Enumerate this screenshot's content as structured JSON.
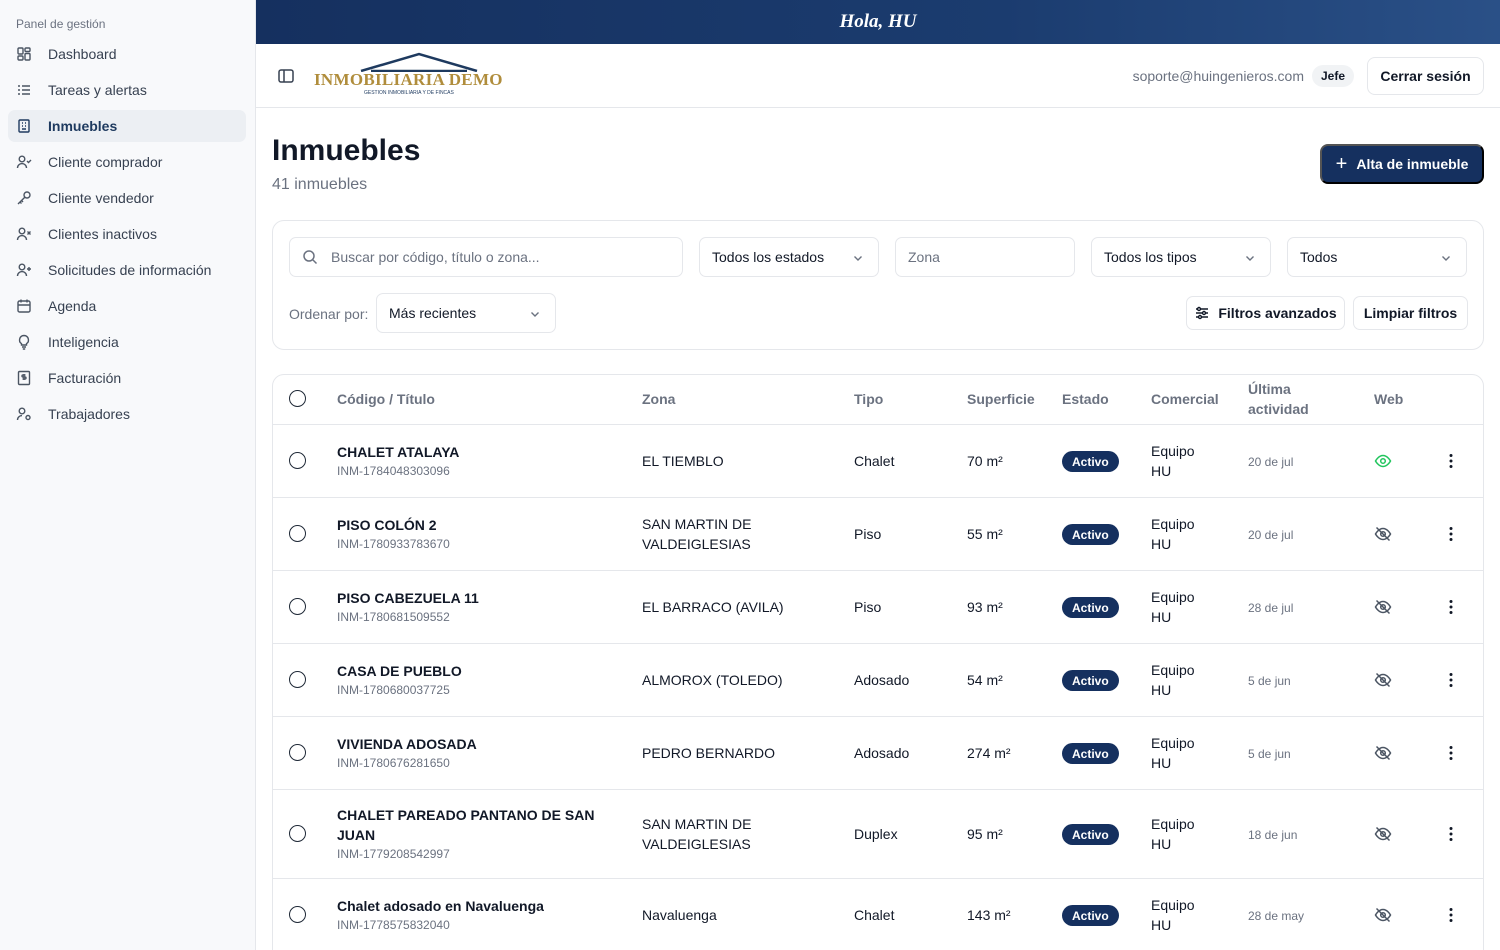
{
  "sidebar": {
    "heading": "Panel de gestión",
    "items": [
      {
        "label": "Dashboard",
        "icon": "dashboard-icon"
      },
      {
        "label": "Tareas y alertas",
        "icon": "list-icon"
      },
      {
        "label": "Inmuebles",
        "icon": "building-icon",
        "active": true
      },
      {
        "label": "Cliente comprador",
        "icon": "user-check-icon"
      },
      {
        "label": "Cliente vendedor",
        "icon": "key-icon"
      },
      {
        "label": "Clientes inactivos",
        "icon": "user-x-icon"
      },
      {
        "label": "Solicitudes de información",
        "icon": "user-plus-icon"
      },
      {
        "label": "Agenda",
        "icon": "calendar-icon"
      },
      {
        "label": "Inteligencia",
        "icon": "lightbulb-icon"
      },
      {
        "label": "Facturación",
        "icon": "receipt-icon"
      },
      {
        "label": "Trabajadores",
        "icon": "user-cog-icon"
      }
    ]
  },
  "banner": {
    "greeting": "Hola, HU"
  },
  "header": {
    "logo_text": "INMOBILIARIA DEMO",
    "logo_subtitle": "GESTION INMOBILIARIA Y DE FINCAS",
    "email": "soporte@huingenieros.com",
    "role": "Jefe",
    "logout_label": "Cerrar sesión"
  },
  "page": {
    "title": "Inmuebles",
    "subtitle": "41 inmuebles",
    "add_button": "Alta de inmueble"
  },
  "filters": {
    "search_placeholder": "Buscar por código, título o zona...",
    "estado": "Todos los estados",
    "zona_placeholder": "Zona",
    "tipo": "Todos los tipos",
    "web": "Todos",
    "sort_label": "Ordenar por:",
    "sort_value": "Más recientes",
    "advanced_label": "Filtros avanzados",
    "clear_label": "Limpiar filtros"
  },
  "table": {
    "headers": {
      "codigo": "Código / Título",
      "zona": "Zona",
      "tipo": "Tipo",
      "superficie": "Superficie",
      "estado": "Estado",
      "comercial": "Comercial",
      "ultima_1": "Última",
      "ultima_2": "actividad",
      "web": "Web"
    },
    "rows": [
      {
        "title": "CHALET ATALAYA",
        "code": "INM-1784048303096",
        "zona": "EL TIEMBLO",
        "tipo": "Chalet",
        "superficie": "70 m²",
        "estado": "Activo",
        "comercial_1": "Equipo",
        "comercial_2": "HU",
        "actividad": "20 de jul",
        "web_visible": true
      },
      {
        "title": "PISO COLÓN 2",
        "code": "INM-1780933783670",
        "zona_1": "SAN MARTIN DE",
        "zona_2": "VALDEIGLESIAS",
        "tipo": "Piso",
        "superficie": "55 m²",
        "estado": "Activo",
        "comercial_1": "Equipo",
        "comercial_2": "HU",
        "actividad": "20 de jul",
        "web_visible": false
      },
      {
        "title": "PISO CABEZUELA 11",
        "code": "INM-1780681509552",
        "zona": "EL BARRACO (AVILA)",
        "tipo": "Piso",
        "superficie": "93 m²",
        "estado": "Activo",
        "comercial_1": "Equipo",
        "comercial_2": "HU",
        "actividad": "28 de jul",
        "web_visible": false
      },
      {
        "title": "CASA DE PUEBLO",
        "code": "INM-1780680037725",
        "zona": "ALMOROX (TOLEDO)",
        "tipo": "Adosado",
        "superficie": "54 m²",
        "estado": "Activo",
        "comercial_1": "Equipo",
        "comercial_2": "HU",
        "actividad": "5 de jun",
        "web_visible": false
      },
      {
        "title": "VIVIENDA ADOSADA",
        "code": "INM-1780676281650",
        "zona": "PEDRO BERNARDO",
        "tipo": "Adosado",
        "superficie": "274 m²",
        "estado": "Activo",
        "comercial_1": "Equipo",
        "comercial_2": "HU",
        "actividad": "5 de jun",
        "web_visible": false
      },
      {
        "title_1": "CHALET PAREADO PANTANO DE SAN",
        "title_2": "JUAN",
        "code": "INM-1779208542997",
        "zona_1": "SAN MARTIN DE",
        "zona_2": "VALDEIGLESIAS",
        "tipo": "Duplex",
        "superficie": "95 m²",
        "estado": "Activo",
        "comercial_1": "Equipo",
        "comercial_2": "HU",
        "actividad": "18 de jun",
        "web_visible": false
      },
      {
        "title": "Chalet adosado en Navaluenga",
        "code": "INM-1778575832040",
        "zona": "Navaluenga",
        "tipo": "Chalet",
        "superficie": "143 m²",
        "estado": "Activo",
        "comercial_1": "Equipo",
        "comercial_2": "HU",
        "actividad": "28 de may",
        "web_visible": false
      }
    ]
  },
  "colors": {
    "primary": "#15305f",
    "web_visible": "#22c55e",
    "web_hidden": "#4b5563",
    "logo_gold": "#b08d3c"
  }
}
